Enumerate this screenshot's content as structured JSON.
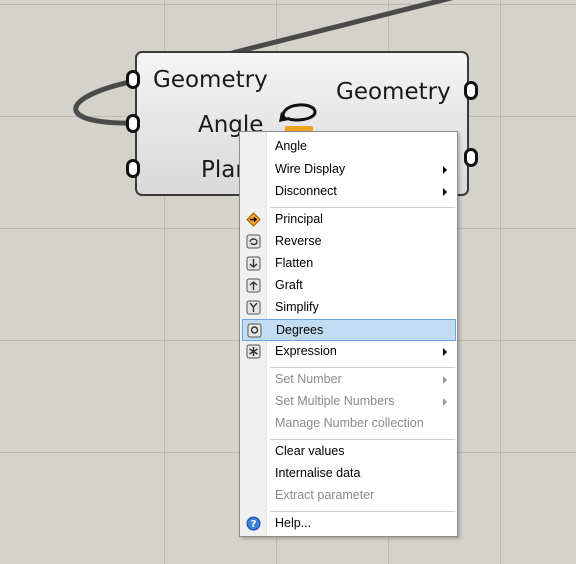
{
  "component": {
    "inputs": [
      "Geometry",
      "Angle",
      "Plane"
    ],
    "visible_inputs": [
      "Geometry",
      "Angle",
      "Plar"
    ],
    "output": "Geometry"
  },
  "menu": {
    "title": "Angle",
    "wire_display": "Wire Display",
    "disconnect": "Disconnect",
    "principal": "Principal",
    "reverse": "Reverse",
    "flatten": "Flatten",
    "graft": "Graft",
    "simplify": "Simplify",
    "degrees": "Degrees",
    "expression": "Expression",
    "set_number": "Set Number",
    "set_multiple_numbers": "Set Multiple Numbers",
    "manage_collection": "Manage Number collection",
    "clear_values": "Clear values",
    "internalise_data": "Internalise data",
    "extract_parameter": "Extract parameter",
    "help": "Help..."
  },
  "colors": {
    "canvas": "#d5d1cb",
    "grid": "#bdb9b3",
    "highlight": "#c2dcf3",
    "highlight_border": "#66a7e8",
    "principal_icon": "#f5a623"
  }
}
